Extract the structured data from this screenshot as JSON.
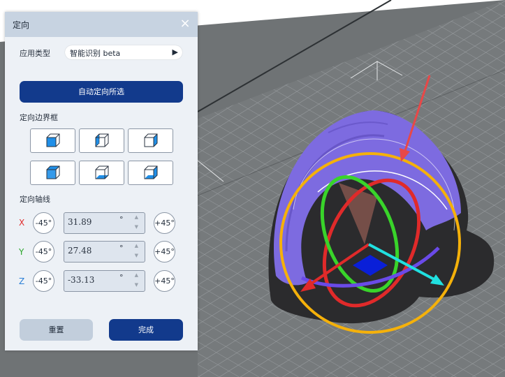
{
  "panel": {
    "title": "定向",
    "close_icon": "×"
  },
  "app_type": {
    "label": "应用类型",
    "value": "智能识别 beta",
    "arrow": "▶"
  },
  "auto_orient_button": "自动定向所选",
  "bbox": {
    "label": "定向边界框",
    "buttons": [
      "cube-front-face",
      "cube-left-face",
      "cube-right-face",
      "cube-top-face",
      "cube-bottom-face",
      "cube-right-bottom-face"
    ]
  },
  "axes": {
    "label": "定向轴线",
    "minus_label": "-45°",
    "plus_label": "+45°",
    "degree_symbol": "°",
    "rows": [
      {
        "name": "X",
        "value": "31.89",
        "color": "#e02a2a"
      },
      {
        "name": "Y",
        "value": "27.48",
        "color": "#2aa52a"
      },
      {
        "name": "Z",
        "value": "-33.13",
        "color": "#2a7fd6"
      }
    ]
  },
  "reset_button": "重置",
  "done_button": "完成",
  "colors": {
    "accent": "#123a8c",
    "face_highlight": "#1f8fe8",
    "model": "#7d6be0",
    "ring": "#f5b10a"
  }
}
